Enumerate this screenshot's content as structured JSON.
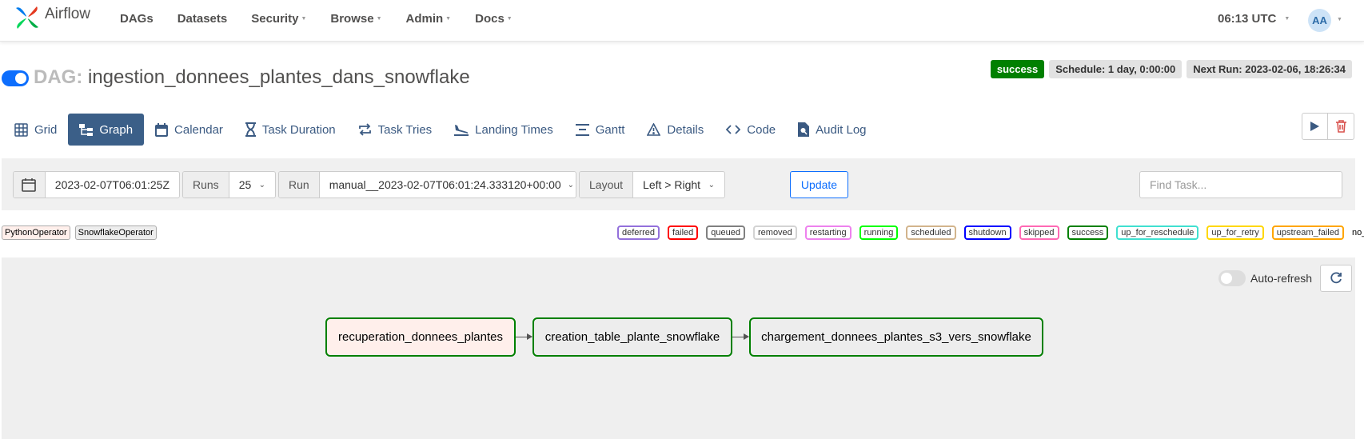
{
  "app": {
    "name": "Airflow"
  },
  "nav": {
    "items": [
      {
        "label": "DAGs",
        "dropdown": false
      },
      {
        "label": "Datasets",
        "dropdown": false
      },
      {
        "label": "Security",
        "dropdown": true
      },
      {
        "label": "Browse",
        "dropdown": true
      },
      {
        "label": "Admin",
        "dropdown": true
      },
      {
        "label": "Docs",
        "dropdown": true
      }
    ],
    "clock": "06:13 UTC",
    "user_initials": "AA"
  },
  "dag": {
    "prefix": "DAG:",
    "name": "ingestion_donnees_plantes_dans_snowflake",
    "paused": false,
    "status": "success",
    "schedule": "Schedule: 1 day, 0:00:00",
    "next_run": "Next Run: 2023-02-06, 18:26:34"
  },
  "tabs": [
    {
      "label": "Grid",
      "icon": "grid-icon",
      "active": false
    },
    {
      "label": "Graph",
      "icon": "graph-icon",
      "active": true
    },
    {
      "label": "Calendar",
      "icon": "calendar-icon",
      "active": false
    },
    {
      "label": "Task Duration",
      "icon": "hourglass-icon",
      "active": false
    },
    {
      "label": "Task Tries",
      "icon": "repeat-icon",
      "active": false
    },
    {
      "label": "Landing Times",
      "icon": "plane-landing-icon",
      "active": false
    },
    {
      "label": "Gantt",
      "icon": "gantt-icon",
      "active": false
    },
    {
      "label": "Details",
      "icon": "warning-triangle-icon",
      "active": false
    },
    {
      "label": "Code",
      "icon": "code-icon",
      "active": false
    },
    {
      "label": "Audit Log",
      "icon": "file-search-icon",
      "active": false
    }
  ],
  "filters": {
    "base_date": "2023-02-07T06:01:25Z",
    "runs_label": "Runs",
    "runs_value": "25",
    "run_label": "Run",
    "run_value": "manual__2023-02-07T06:01:24.333120+00:00",
    "layout_label": "Layout",
    "layout_value": "Left > Right",
    "update_label": "Update",
    "find_task_placeholder": "Find Task..."
  },
  "legend": {
    "operators": [
      {
        "label": "PythonOperator",
        "color": "#ffefeb"
      },
      {
        "label": "SnowflakeOperator",
        "color": "#ededed"
      }
    ],
    "states": [
      {
        "label": "deferred",
        "color": "#9370db"
      },
      {
        "label": "failed",
        "color": "#ff0000"
      },
      {
        "label": "queued",
        "color": "#808080"
      },
      {
        "label": "removed",
        "color": "#d3d3d3"
      },
      {
        "label": "restarting",
        "color": "#ee82ee"
      },
      {
        "label": "running",
        "color": "#00ff00"
      },
      {
        "label": "scheduled",
        "color": "#d2b48c"
      },
      {
        "label": "shutdown",
        "color": "#0000ff"
      },
      {
        "label": "skipped",
        "color": "#ff69b4"
      },
      {
        "label": "success",
        "color": "#008000"
      },
      {
        "label": "up_for_reschedule",
        "color": "#40e0d0"
      },
      {
        "label": "up_for_retry",
        "color": "#ffd700"
      },
      {
        "label": "upstream_failed",
        "color": "#ffa500"
      },
      {
        "label": "no_status",
        "color": ""
      }
    ]
  },
  "graph": {
    "auto_refresh_label": "Auto-refresh",
    "tasks": [
      {
        "id": "recuperation_donnees_plantes",
        "operator": "PythonOperator",
        "state": "success"
      },
      {
        "id": "creation_table_plante_snowflake",
        "operator": "SnowflakeOperator",
        "state": "success"
      },
      {
        "id": "chargement_donnees_plantes_s3_vers_snowflake",
        "operator": "SnowflakeOperator",
        "state": "success"
      }
    ]
  }
}
